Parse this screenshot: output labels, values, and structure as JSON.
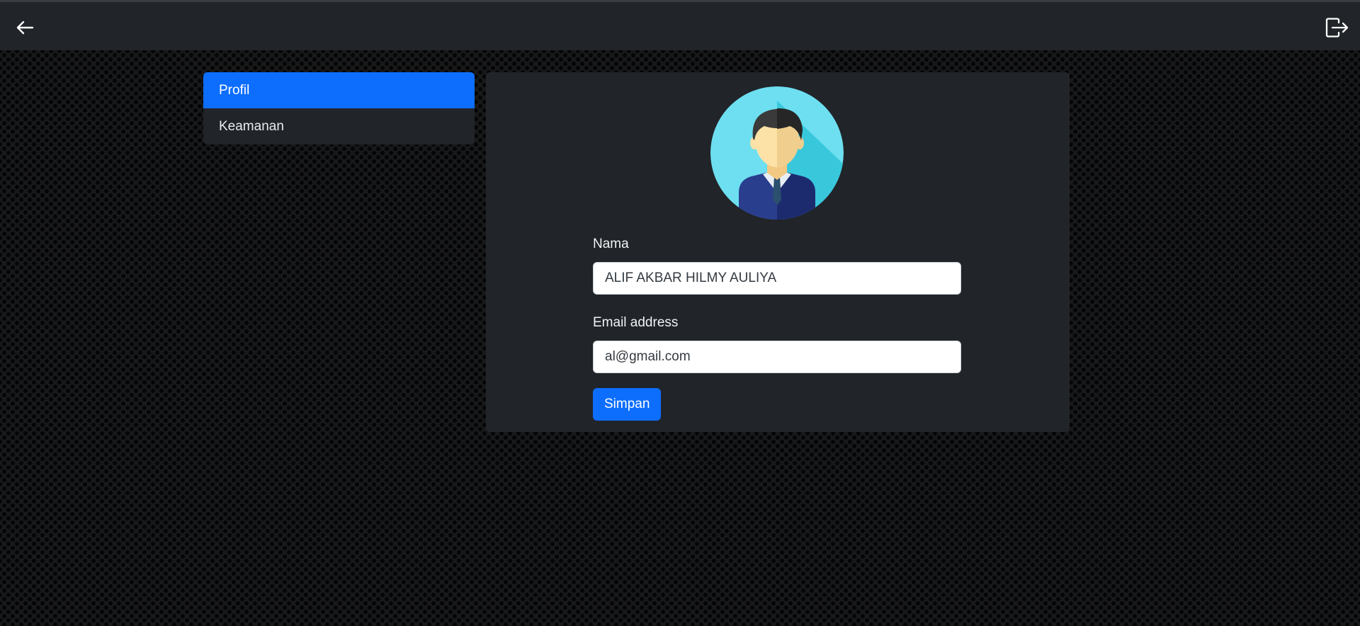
{
  "header": {
    "back_icon": "arrow-left-icon",
    "logout_icon": "box-arrow-right-icon"
  },
  "sidebar": {
    "items": [
      {
        "label": "Profil",
        "active": true
      },
      {
        "label": "Keamanan",
        "active": false
      }
    ]
  },
  "profile": {
    "avatar_icon": "user-avatar-icon",
    "name_label": "Nama",
    "name_value": "ALIF AKBAR HILMY AULIYA",
    "email_label": "Email address",
    "email_value": "al@gmail.com",
    "save_label": "Simpan"
  },
  "colors": {
    "primary": "#0d6efd",
    "panel": "#212429",
    "background": "#18191b"
  }
}
